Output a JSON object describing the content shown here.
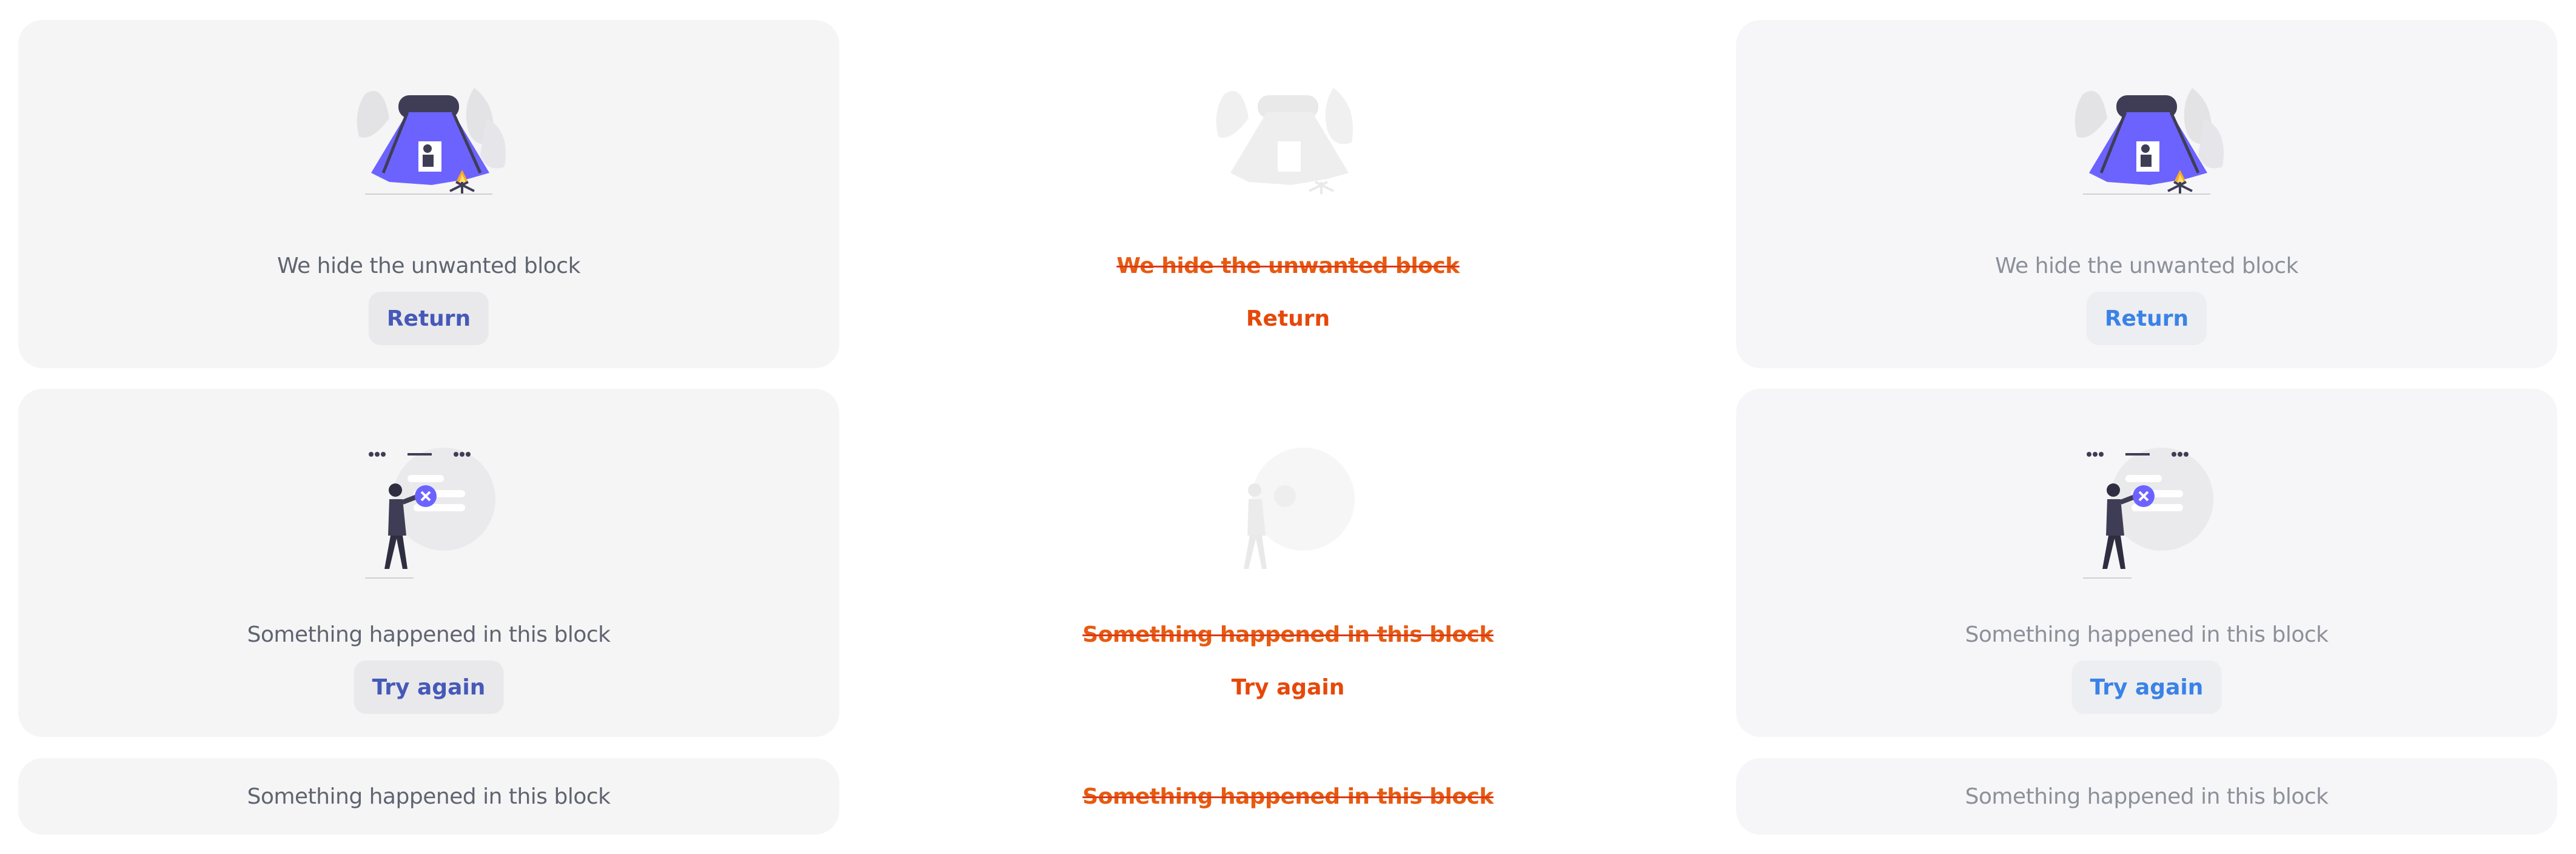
{
  "columns": [
    {
      "variant": "default",
      "hidden_block": {
        "message": "We hide the unwanted block",
        "button": "Return",
        "illustration": "camping-tent-illustration"
      },
      "error_block": {
        "message": "Something happened in this block",
        "button": "Try again",
        "illustration": "person-holding-error-illustration"
      },
      "compact_error": {
        "message": "Something happened in this block"
      }
    },
    {
      "variant": "highlighted",
      "hidden_block": {
        "message": "We hide the unwanted block",
        "button": "Return",
        "illustration": "camping-tent-illustration"
      },
      "error_block": {
        "message": "Something happened in this block",
        "button": "Try again",
        "illustration": "person-holding-error-illustration"
      },
      "compact_error": {
        "message": "Something happened in this block"
      }
    },
    {
      "variant": "light",
      "hidden_block": {
        "message": "We hide the unwanted block",
        "button": "Return",
        "illustration": "camping-tent-illustration"
      },
      "error_block": {
        "message": "Something happened in this block",
        "button": "Try again",
        "illustration": "person-holding-error-illustration"
      },
      "compact_error": {
        "message": "Something happened in this block"
      }
    }
  ],
  "colors": {
    "card_background": "#f5f5f6",
    "default_button_text": "#4659b8",
    "light_button_text": "#3b82e6",
    "highlight_text": "#e85a10",
    "illustration_accent": "#6c63ff",
    "fire_accent": "#f9a826"
  }
}
